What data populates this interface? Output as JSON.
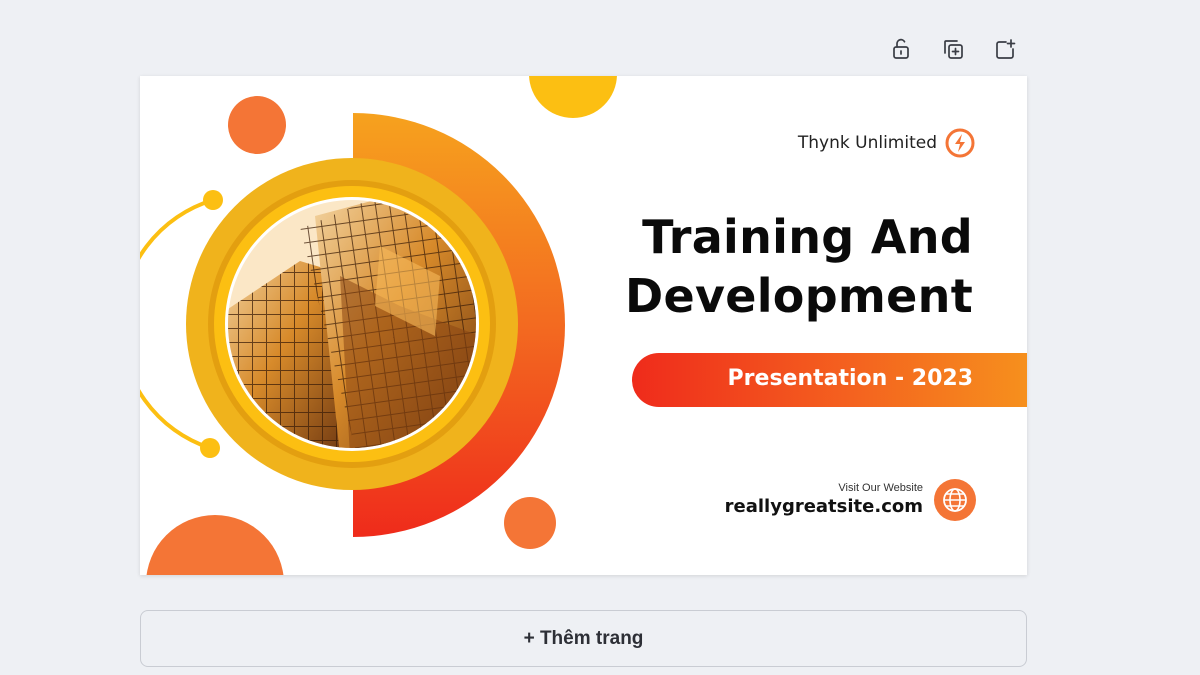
{
  "toolbar": {
    "lock_icon": "unlock-icon",
    "duplicate_icon": "duplicate-page-icon",
    "add_icon": "add-page-icon"
  },
  "slide": {
    "brand": "Thynk Unlimited",
    "title_line1": "Training And",
    "title_line2": "Development",
    "subtitle": "Presentation - 2023",
    "visit_label": "Visit Our Website",
    "website": "reallygreatsite.com",
    "colors": {
      "orange": "#f47536",
      "yellow": "#fcbf12",
      "red": "#ef2b1b",
      "gold": "#f0b31c"
    }
  },
  "add_page": {
    "label": "+ Thêm trang"
  }
}
